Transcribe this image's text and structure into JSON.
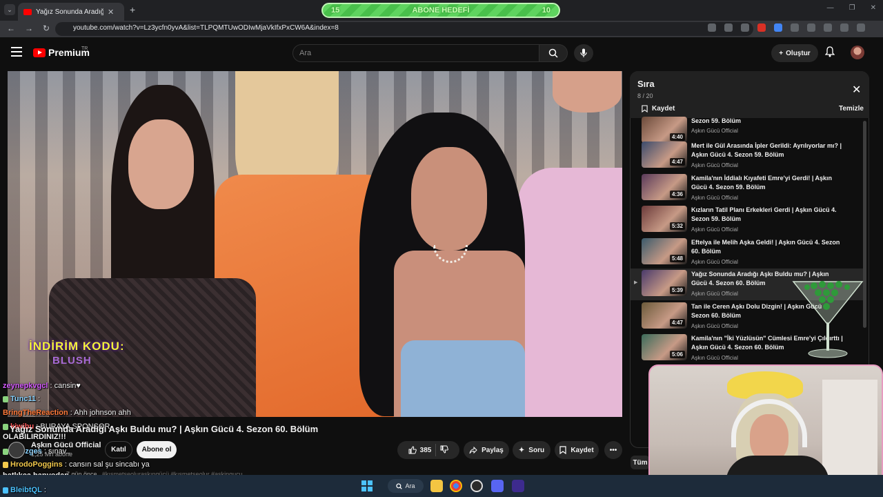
{
  "browser": {
    "tab_title": "Yağız Sonunda Aradığı Aşkı",
    "close_tab": "✕",
    "new_tab": "+",
    "url": "youtube.com/watch?v=Lz3ycfn0yvA&list=TLPQMTUwODIwMjaVkIfxPxCW6A&index=8",
    "goal_left": "15",
    "goal_label": "ABONE HEDEFİ",
    "goal_right": "10"
  },
  "header": {
    "logo_text": "Premium",
    "logo_country": "TR",
    "search_placeholder": "Ara",
    "create_label": "Oluştur"
  },
  "video": {
    "promo_line1": "İNDİRİM KODU:",
    "promo_line2": "BLUSH",
    "title": "Yağız Sonunda Aradığı Aşkı Buldu mu? | Aşkın Gücü 4. Sezon 60. Bölüm",
    "channel": "Aşkın Gücü Official",
    "subs": "1,25 Mn abone",
    "join": "Katıl",
    "subscribe": "Abone ol",
    "likes": "385",
    "share": "Paylaş",
    "ask": "Soru",
    "save": "Kaydet",
    "desc_meta": "7 gün önce",
    "desc_tags": "#kısmetseolurașkıngücü #kısmetseolur #askingucu"
  },
  "chat": [
    {
      "user": "zeynepkvgcl",
      "msg": " : cansin♥",
      "color": "#d65cff"
    },
    {
      "user": "Tunc11",
      "msg": " : ",
      "color": "#8ad3ff"
    },
    {
      "user": "BringTheReaction",
      "msg": " : Ahh johnson ahh",
      "color": "#ff7a3a"
    },
    {
      "user": "kiwibu",
      "msg": " : BURAYA SPONSOR",
      "color": "#ff5b5b"
    },
    {
      "user": "",
      "msg": "OLABILIRDINIZ!!!",
      "color": "#ffffff"
    },
    {
      "user": "btrozges",
      "msg": " : sınav..",
      "color": "#8ad3ff"
    },
    {
      "user": "HrodoPoggins",
      "msg": " : cansın sal şu sincabı ya",
      "color": "#f2c94c"
    },
    {
      "user": "",
      "msg": "batlıkça banyodan",
      "color": "#ffffff"
    },
    {
      "user": "BleibtQL",
      "msg": " : ",
      "color": "#4cc2ff"
    }
  ],
  "playlist": {
    "title": "Sıra",
    "count": "8 / 20",
    "save": "Kaydet",
    "clear": "Temizle",
    "items": [
      {
        "title": "Sezon 59. Bölüm",
        "channel": "Aşkın Gücü Official",
        "duration": "4:40",
        "active": false
      },
      {
        "title": "Mert ile Gül Arasında İpler Gerildi: Ayrılıyorlar mı? | Aşkın Gücü 4. Sezon 59. Bölüm",
        "channel": "Aşkın Gücü Official",
        "duration": "4:47",
        "active": false
      },
      {
        "title": "Kamila'nın İddialı Kıyafeti Emre'yi Gerdi! | Aşkın Gücü 4. Sezon 59. Bölüm",
        "channel": "Aşkın Gücü Official",
        "duration": "4:36",
        "active": false
      },
      {
        "title": "Kızların Tatil Planı Erkekleri Gerdi | Aşkın Gücü 4. Sezon 59. Bölüm",
        "channel": "Aşkın Gücü Official",
        "duration": "5:32",
        "active": false
      },
      {
        "title": "Eftelya ile Melih Aşka Geldi! | Aşkın Gücü 4. Sezon 60. Bölüm",
        "channel": "Aşkın Gücü Official",
        "duration": "5:48",
        "active": false
      },
      {
        "title": "Yağız Sonunda Aradığı Aşkı Buldu mu? | Aşkın Gücü 4. Sezon 60. Bölüm",
        "channel": "Aşkın Gücü Official",
        "duration": "5:39",
        "active": true
      },
      {
        "title": "Tan ile Ceren Aşkı Dolu Dizgin! | Aşkın Gücü 4. Sezon 60. Bölüm",
        "channel": "Aşkın Gücü Official",
        "duration": "4:47",
        "active": false
      },
      {
        "title": "Kamila'nın \"İki Yüzlüsün\" Cümlesi Emre'yi Çıldırttı | Aşkın Gücü 4. Sezon 60. Bölüm",
        "channel": "Aşkın Gücü Official",
        "duration": "5:06",
        "active": false
      }
    ],
    "chip": "Tüm"
  },
  "taskbar": {
    "search": "Ara"
  }
}
